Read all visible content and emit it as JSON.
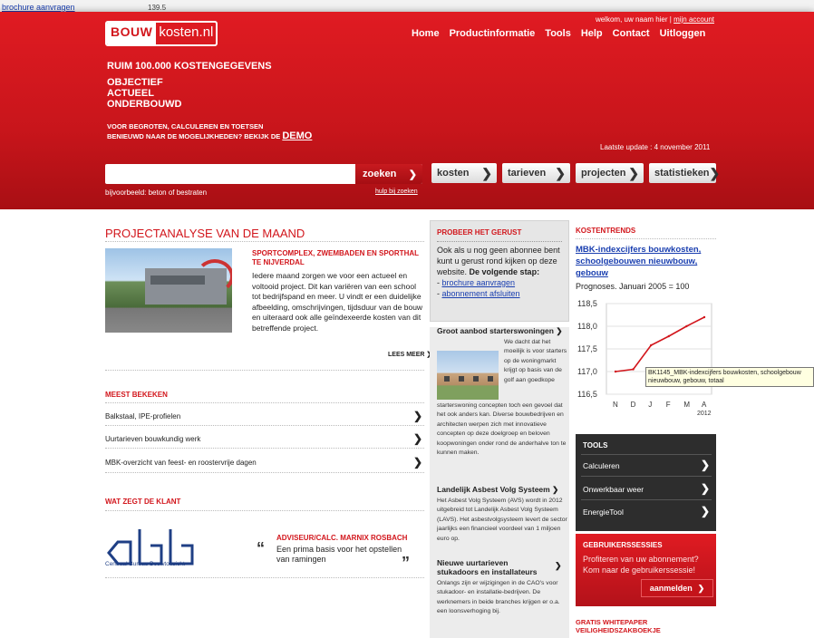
{
  "background_window": {
    "link": "brochure aanvragen",
    "number": "139.5"
  },
  "header": {
    "logo_part1": "BOUW",
    "logo_part2": "kosten.nl",
    "welcome_prefix": "welkom, uw naam hier |",
    "my_account": "mijn account",
    "nav": [
      "Home",
      "Productinformatie",
      "Tools",
      "Help",
      "Contact",
      "Uitloggen"
    ],
    "hero_title": "RUIM 100.000 KOSTENGEGEVENS",
    "hero_lines": [
      "OBJECTIEF",
      "ACTUEEL",
      "ONDERBOUWD"
    ],
    "hero_sub1": "VOOR BEGROTEN, CALCULEREN EN TOETSEN",
    "hero_sub2": "BENIEUWD NAAR DE MOGELIJKHEDEN? BEKIJK DE",
    "hero_demo": "DEMO",
    "update": "Laatste update : 4 november 2011"
  },
  "search": {
    "value": "",
    "button": "zoeken",
    "example": "bijvoorbeeld: beton of bestraten",
    "help": "hulp bij zoeken"
  },
  "categories": [
    "kosten",
    "tarieven",
    "projecten",
    "statistieken"
  ],
  "project": {
    "heading": "PROJECTANALYSE VAN DE MAAND",
    "title": "SPORTCOMPLEX, ZWEMBADEN EN SPORTHAL TE NIJVERDAL",
    "text": "Iedere maand zorgen we voor een actueel en voltooid project. Dit kan variëren van een school tot bedrijfspand en meer. U vindt er een duidelijke afbeelding, omschrijvingen, tijdsduur van de bouw en uiteraard ook alle geïndexeerde kosten van dit betreffende project.",
    "more": "LEES MEER"
  },
  "meest": {
    "heading": "MEEST BEKEKEN",
    "items": [
      "Balkstaal, IPE-profielen",
      "Uurtarieven bouwkundig werk",
      "MBK-overzicht van feest- en roostervrije dagen"
    ]
  },
  "klant": {
    "heading": "WAT ZEGT DE KLANT",
    "logo_text": "Centraal Bureau Bouwtoezicht",
    "name": "ADVISEUR/CALC. MARNIX ROSBACH",
    "quote": "Een prima basis voor het opstellen van ramingen"
  },
  "probeer": {
    "heading": "PROBEER HET GERUST",
    "text": "Ook als u nog geen abonnee bent kunt u gerust rond kijken op deze website.",
    "bold": "De volgende stap:",
    "link1": "brochure aanvragen",
    "link2": "abonnement afsluiten"
  },
  "news": [
    {
      "title": "Groot aanbod starterswoningen",
      "text_side": "We dacht dat het moeilijk is voor starters op de woningmarkt krijgt op basis van de golf aan goedkope",
      "text": "starterswoning concepten toch een gevoel dat het ook anders kan. Diverse bouwbedrijven en architecten werpen zich met innovatieve concepten op deze doelgroep en beloven koopwoningen onder rond de anderhalve ton te kunnen maken."
    },
    {
      "title": "Landelijk Asbest Volg Systeem",
      "text": "Het Asbest Volg Systeem (AVS) wordt in 2012 uitgebreid tot Landelijk Asbest Volg Systeem (LAVS). Het asbestvolgsysteem levert de sector jaarlijks een financieel voordeel van 1 miljoen euro op."
    },
    {
      "title": "Nieuwe uurtarieven stukadoors en installateurs",
      "text": "Onlangs zijn er wijzigingen in de CAO's voor stukadoor- en installatie-bedrijven. De werknemers in beide branches krijgen er o.a. een loonsverhoging bij."
    }
  ],
  "kostentrends": {
    "heading": "KOSTENTRENDS",
    "link": "MBK-indexcijfers bouwkosten, schoolgebouwen nieuwbouw, gebouw",
    "note": "Prognoses. Januari 2005 = 100",
    "tooltip1": "BK1145_MBK-indexcijfers bouwkosten, schoolgebouw",
    "tooltip2": "nieuwbouw, gebouw, totaal"
  },
  "chart_data": {
    "type": "line",
    "x": [
      "N",
      "D",
      "J",
      "F",
      "M",
      "A"
    ],
    "x_sub": "2012",
    "series": [
      {
        "values": [
          117.0,
          117.05,
          117.58,
          117.78,
          118.0,
          118.2
        ]
      }
    ],
    "ylim": [
      116.5,
      118.5
    ],
    "yticks": [
      "118,5",
      "118,0",
      "117,5",
      "117,0",
      "116,5"
    ],
    "grid": true
  },
  "tools": {
    "heading": "TOOLS",
    "items": [
      "Calculeren",
      "Onwerkbaar weer",
      "EnergieTool"
    ]
  },
  "sessies": {
    "heading": "GEBRUIKERSSESSIES",
    "text": "Profiteren van uw abonnement? Kom naar de gebruikerssessie!",
    "button": "aanmelden"
  },
  "whitepaper": {
    "line1": "GRATIS WHITEPAPER",
    "line2": "VEILIGHEIDSZAKBOEKJE"
  },
  "colors": {
    "brand_red": "#d2161c",
    "link_blue": "#1a3fb0",
    "tools_bg": "#2d2d2d"
  }
}
